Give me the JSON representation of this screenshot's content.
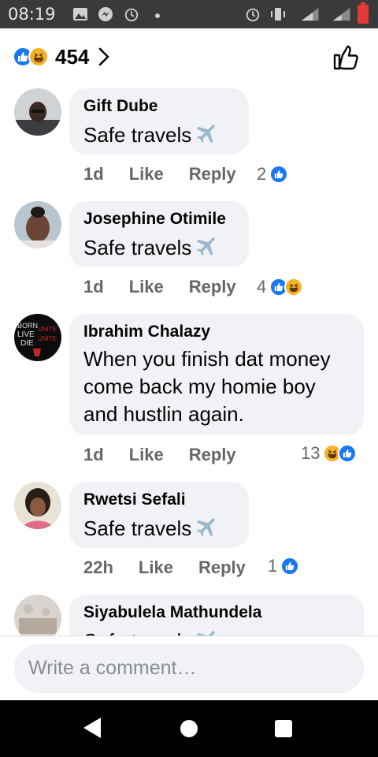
{
  "status_bar": {
    "time": "08:19"
  },
  "reactions_header": {
    "count": "454"
  },
  "comments": [
    {
      "author": "Gift Dube",
      "text": "Safe travels",
      "time": "1d",
      "like": "Like",
      "reply": "Reply",
      "reaction_count": "2",
      "reactions": [
        "like"
      ]
    },
    {
      "author": "Josephine Otimile",
      "text": "Safe travels",
      "time": "1d",
      "like": "Like",
      "reply": "Reply",
      "reaction_count": "4",
      "reactions": [
        "like",
        "haha"
      ]
    },
    {
      "author": "Ibrahim Chalazy",
      "text_lines": [
        "When you finish dat money",
        "come back my homie boy",
        "and hustlin again."
      ],
      "time": "1d",
      "like": "Like",
      "reply": "Reply",
      "reaction_count": "13",
      "reactions": [
        "haha",
        "like"
      ]
    },
    {
      "author": "Rwetsi Sefali",
      "text": "Safe travels",
      "time": "22h",
      "like": "Like",
      "reply": "Reply",
      "reaction_count": "1",
      "reactions": [
        "like"
      ]
    },
    {
      "author": "Siyabulela Mathundela",
      "text": "Safe travels",
      "time": "",
      "like": "",
      "reply": "",
      "reaction_count": "",
      "reactions": []
    }
  ],
  "composer": {
    "placeholder": "Write a comment…"
  },
  "colors": {
    "accent": "#1877f2",
    "haha": "#f7b125",
    "bubble": "#f0f2f5",
    "meta": "#65676b"
  },
  "icons": [
    "like-reaction-icon",
    "haha-reaction-icon",
    "chevron-right-icon",
    "thumbs-up-outline-icon",
    "airplane-icon",
    "back-icon",
    "home-icon",
    "recents-icon"
  ]
}
